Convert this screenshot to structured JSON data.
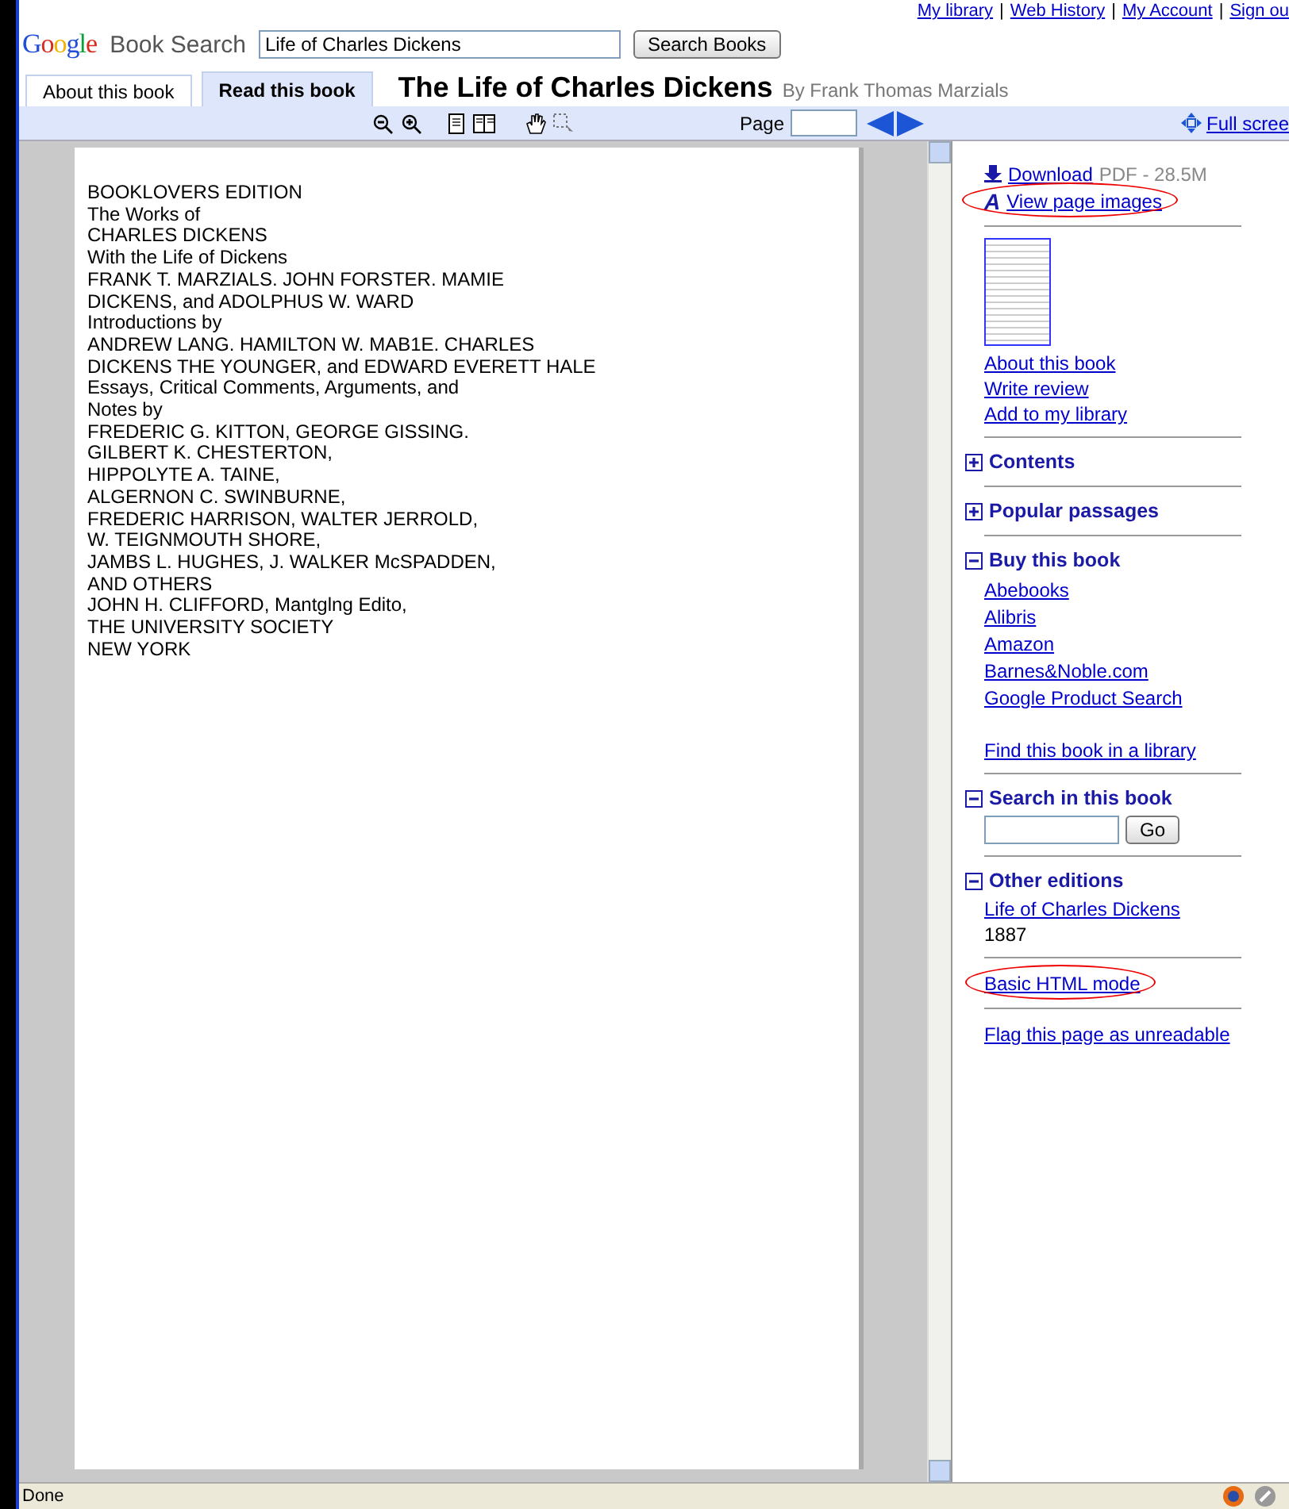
{
  "top_links": {
    "separator": "|",
    "links": [
      "My library",
      "Web History",
      "My Account",
      "Sign ou"
    ]
  },
  "search": {
    "logo": "Google",
    "product": "Book Search",
    "value": "Life of Charles Dickens",
    "button": "Search Books"
  },
  "tabs": [
    {
      "label": "About this book",
      "selected": false
    },
    {
      "label": "Read this book",
      "selected": true
    }
  ],
  "book": {
    "title": "The Life of Charles Dickens",
    "byline": "By Frank Thomas Marzials"
  },
  "toolbar": {
    "page_label": "Page",
    "full_screen": "Full scree"
  },
  "page_lines": [
    "BOOKLOVERS EDITION",
    "The Works of",
    "CHARLES DICKENS",
    "With the Life of Dickens",
    "FRANK T. MARZIALS. JOHN FORSTER. MAMIE",
    "DICKENS, and ADOLPHUS W. WARD",
    "Introductions by",
    "ANDREW LANG. HAMILTON W. MAB1E. CHARLES",
    "DICKENS THE YOUNGER, and EDWARD EVERETT HALE",
    "Essays, Critical Comments, Arguments, and",
    "Notes by",
    "FREDERIC G. KITTON, GEORGE GISSING.",
    "GILBERT K. CHESTERTON,",
    "HIPPOLYTE A. TAINE,",
    "ALGERNON C. SWINBURNE,",
    "FREDERIC HARRISON, WALTER JERROLD,",
    "W. TEIGNMOUTH SHORE,",
    "JAMBS L. HUGHES, J. WALKER McSPADDEN,",
    "AND OTHERS",
    "JOHN H. CLIFFORD, Mantglng Edito,",
    "THE UNIVERSITY SOCIETY",
    "NEW YORK"
  ],
  "sidebar": {
    "download": {
      "link": "Download",
      "info": "PDF - 28.5M"
    },
    "view_images": {
      "icon": "A",
      "label": "View page images",
      "highlighted": true
    },
    "book_links": [
      "About this book",
      "Write review",
      "Add to my library"
    ],
    "sections": [
      {
        "title": "Contents",
        "expanded": false
      },
      {
        "title": "Popular passages",
        "expanded": false
      },
      {
        "kind": "links",
        "title": "Buy this book",
        "expanded": true,
        "links": [
          "Abebooks",
          "Alibris",
          "Amazon",
          "Barnes&Noble.com",
          "Google Product Search"
        ],
        "extra_link": "Find this book in a library"
      },
      {
        "kind": "search",
        "title": "Search in this book",
        "expanded": true,
        "button": "Go"
      },
      {
        "kind": "editions",
        "title": "Other editions",
        "expanded": true,
        "link": "Life of Charles Dickens",
        "year": "1887"
      }
    ],
    "footer_links": [
      {
        "label": "Basic HTML mode",
        "highlighted": true
      },
      {
        "label": "Flag this page as unreadable",
        "highlighted": false
      }
    ]
  },
  "status_bar": {
    "text": "Done"
  }
}
